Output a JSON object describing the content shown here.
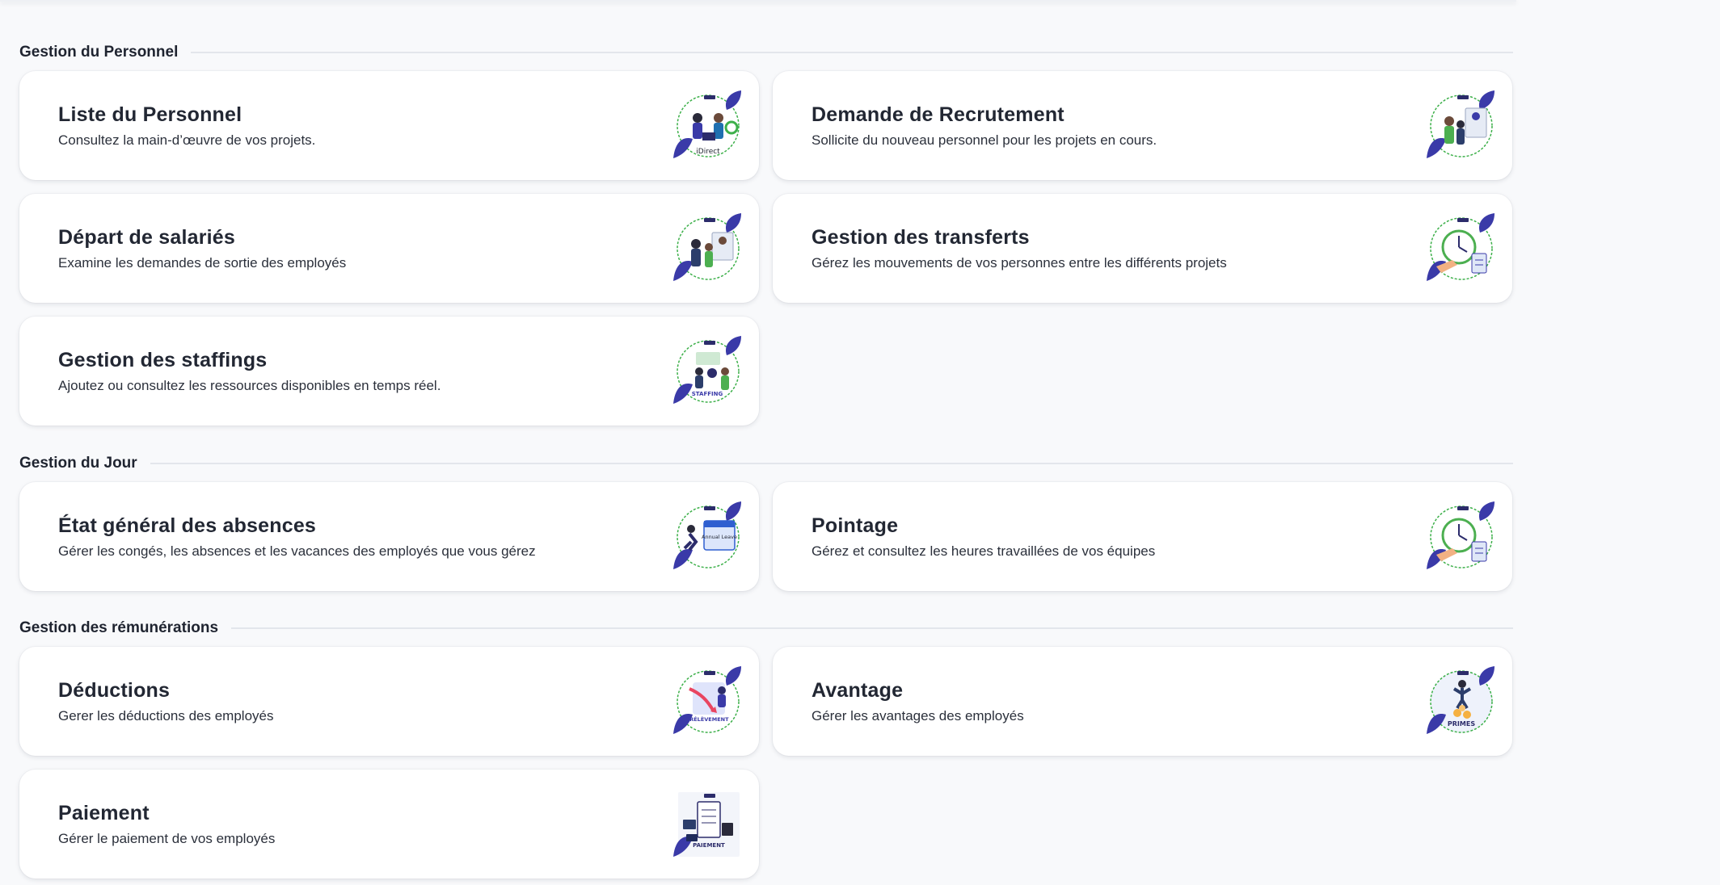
{
  "sections": [
    {
      "title": "Gestion du Personnel",
      "cards": [
        {
          "title": "Liste du Personnel",
          "description": "Consultez la main-d’œuvre de vos projets.",
          "icon": "personnel-list-illustration"
        },
        {
          "title": "Demande de Recrutement",
          "description": "Sollicite du nouveau personnel pour les projets en cours.",
          "icon": "recruitment-illustration"
        },
        {
          "title": "Départ de salariés",
          "description": "Examine les demandes de sortie des employés",
          "icon": "employee-departure-illustration"
        },
        {
          "title": "Gestion des transferts",
          "description": "Gérez les mouvements de vos personnes entre les différents projets",
          "icon": "transfer-clock-illustration"
        },
        {
          "title": "Gestion des staffings",
          "description": "Ajoutez ou consultez les ressources disponibles en temps réel.",
          "icon": "staffing-illustration",
          "badge": "STAFFING"
        }
      ]
    },
    {
      "title": "Gestion du Jour",
      "cards": [
        {
          "title": "État général des absences",
          "description": "Gérer les congés, les absences et les vacances des employés que vous gérez",
          "icon": "annual-leave-calendar-illustration",
          "badge": "Annual Leave"
        },
        {
          "title": "Pointage",
          "description": "Gérez et consultez les heures travaillées de vos équipes",
          "icon": "timesheet-clock-illustration"
        }
      ]
    },
    {
      "title": "Gestion des rémunérations",
      "cards": [
        {
          "title": "Déductions",
          "description": "Gerer les déductions des employés",
          "icon": "deductions-illustration",
          "badge": "PRÉLÈVEMENT"
        },
        {
          "title": "Avantage",
          "description": "Gérer les avantages des employés",
          "icon": "bonus-illustration",
          "badge": "PRIMES"
        },
        {
          "title": "Paiement",
          "description": "Gérer le paiement de vos employés",
          "icon": "payment-illustration",
          "badge": "PAIEMENT"
        }
      ]
    }
  ],
  "colors": {
    "background": "#f8f9fb",
    "card": "#ffffff",
    "leaf_accent": "#3a3aa8",
    "ring_accent": "#3db04a"
  }
}
